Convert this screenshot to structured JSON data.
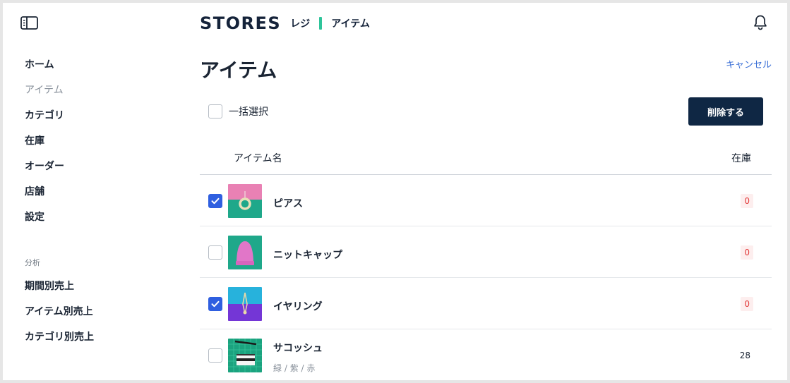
{
  "header": {
    "brand": "STORES",
    "sub": "レジ",
    "section": "アイテム"
  },
  "sidebar": {
    "items": [
      {
        "label": "ホーム"
      },
      {
        "label": "アイテム"
      },
      {
        "label": "カテゴリ"
      },
      {
        "label": "在庫"
      },
      {
        "label": "オーダー"
      },
      {
        "label": "店舗"
      },
      {
        "label": "設定"
      }
    ],
    "analysis_heading": "分析",
    "analysis_items": [
      {
        "label": "期間別売上"
      },
      {
        "label": "アイテム別売上"
      },
      {
        "label": "カテゴリ別売上"
      }
    ]
  },
  "main": {
    "title": "アイテム",
    "cancel_label": "キャンセル",
    "select_all_label": "一括選択",
    "delete_label": "削除する",
    "columns": {
      "name": "アイテム名",
      "stock": "在庫"
    },
    "items": [
      {
        "name": "ピアス",
        "variant": "",
        "stock": "0",
        "checked": true
      },
      {
        "name": "ニットキャップ",
        "variant": "",
        "stock": "0",
        "checked": false
      },
      {
        "name": "イヤリング",
        "variant": "",
        "stock": "0",
        "checked": true
      },
      {
        "name": "サコッシュ",
        "variant": "緑 / 紫 / 赤",
        "stock": "28",
        "checked": false
      }
    ]
  },
  "colors": {
    "accent": "#2ec49a",
    "primary_button": "#0f2744",
    "checkbox_checked": "#2f5fe0",
    "link": "#3a6fd6",
    "zero_stock": "#e23c3c"
  }
}
